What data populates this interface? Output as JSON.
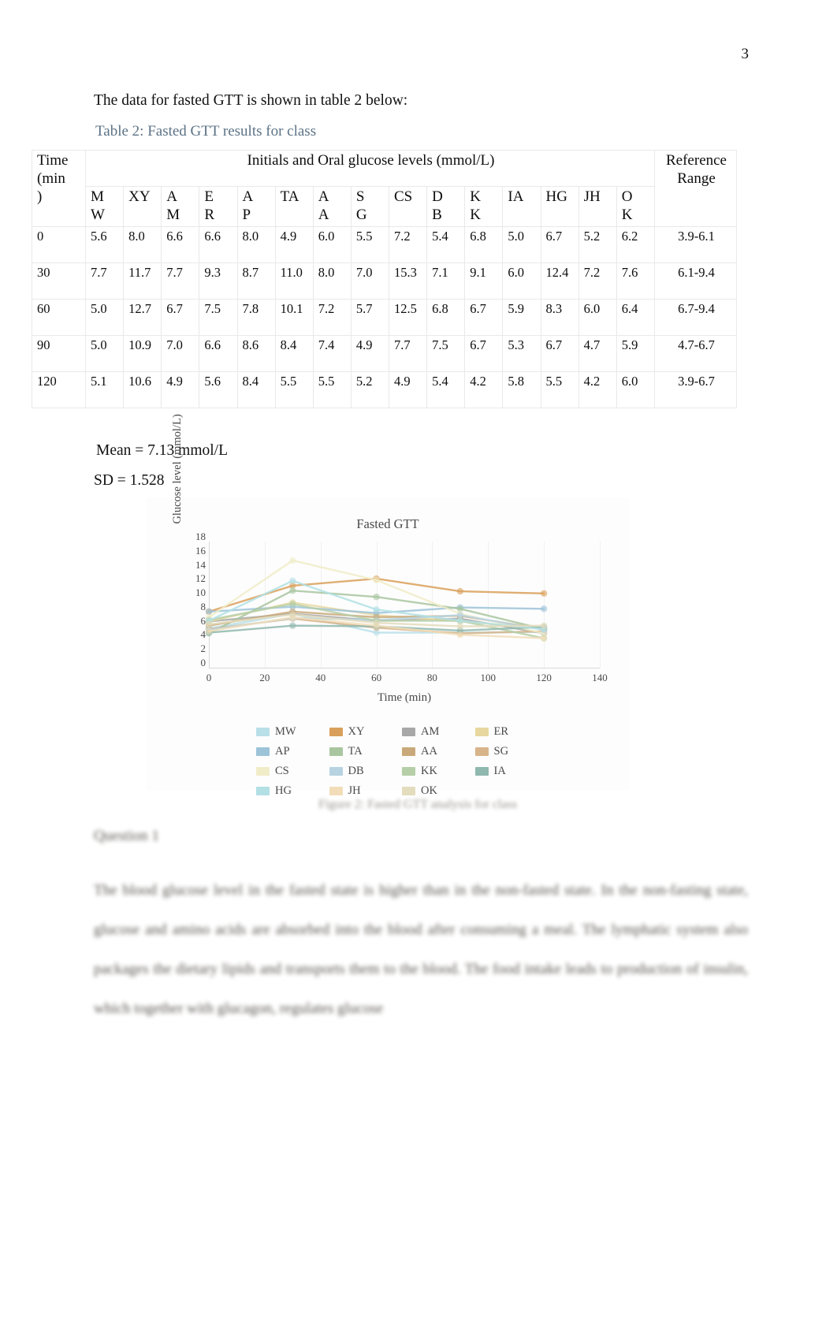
{
  "page": {
    "number": "3",
    "intro_text": "The data for fasted GTT is shown in table 2 below:",
    "table_caption": "Table 2: Fasted GTT results for class",
    "mean_text": "Mean  = 7.13 mmol/L",
    "sd_text": "SD = 1.528",
    "figure_caption": "Figure 2: Fasted GTT analysis for class",
    "question_heading": "Question 1",
    "body_paragraph": "The blood glucose level in the fasted state is higher than in the non-fasted state. In the non-fasting state, glucose and amino acids are absorbed into the blood after consuming a meal. The lymphatic system also packages the dietary lipids and transports them to the blood. The food intake leads to production of insulin, which together with glucagon, regulates glucose"
  },
  "table": {
    "time_header": "Time (min)",
    "time_header_lines": [
      "Time",
      "(min",
      ")"
    ],
    "group_header": "Initials and Oral glucose levels (mmol/L)",
    "reference_header": "Reference Range",
    "reference_header_lines": [
      "Reference",
      "Range"
    ],
    "initials": [
      "MW",
      "XY",
      "AM",
      "ER",
      "AP",
      "TA",
      "AA",
      "SG",
      "CS",
      "DB",
      "KK",
      "IA",
      "HG",
      "JH",
      "OK"
    ],
    "initials_wrapped": [
      [
        "M",
        "W"
      ],
      [
        "XY",
        ""
      ],
      [
        "A",
        "M"
      ],
      [
        "E",
        "R"
      ],
      [
        "A",
        "P"
      ],
      [
        "TA",
        ""
      ],
      [
        "A",
        "A"
      ],
      [
        "S",
        "G"
      ],
      [
        "CS",
        ""
      ],
      [
        "D",
        "B"
      ],
      [
        "K",
        "K"
      ],
      [
        "IA",
        ""
      ],
      [
        "HG",
        ""
      ],
      [
        "JH",
        ""
      ],
      [
        "O",
        "K"
      ]
    ],
    "rows": [
      {
        "time": "0",
        "values": [
          "5.6",
          "8.0",
          "6.6",
          "6.6",
          "8.0",
          "4.9",
          "6.0",
          "5.5",
          "7.2",
          "5.4",
          "6.8",
          "5.0",
          "6.7",
          "5.2",
          "6.2"
        ],
        "reference": "3.9-6.1"
      },
      {
        "time": "30",
        "values": [
          "7.7",
          "11.7",
          "7.7",
          "9.3",
          "8.7",
          "11.0",
          "8.0",
          "7.0",
          "15.3",
          "7.1",
          "9.1",
          "6.0",
          "12.4",
          "7.2",
          "7.6"
        ],
        "reference": "6.1-9.4"
      },
      {
        "time": "60",
        "values": [
          "5.0",
          "12.7",
          "6.7",
          "7.5",
          "7.8",
          "10.1",
          "7.2",
          "5.7",
          "12.5",
          "6.8",
          "6.7",
          "5.9",
          "8.3",
          "6.0",
          "6.4"
        ],
        "reference": "6.7-9.4"
      },
      {
        "time": "90",
        "values": [
          "5.0",
          "10.9",
          "7.0",
          "6.6",
          "8.6",
          "8.4",
          "7.4",
          "4.9",
          "7.7",
          "7.5",
          "6.7",
          "5.3",
          "6.7",
          "4.7",
          "5.9"
        ],
        "reference": "4.7-6.7"
      },
      {
        "time": "120",
        "values": [
          "5.1",
          "10.6",
          "4.9",
          "5.6",
          "8.4",
          "5.5",
          "5.5",
          "5.2",
          "4.9",
          "5.4",
          "4.2",
          "5.8",
          "5.5",
          "4.2",
          "6.0"
        ],
        "reference": "3.9-6.7"
      }
    ]
  },
  "chart_data": {
    "type": "line",
    "title": "Fasted GTT",
    "xlabel": "Time (min)",
    "ylabel": "Glucose level (mmol/L)",
    "x": [
      0,
      30,
      60,
      90,
      120
    ],
    "xlim": [
      0,
      140
    ],
    "ylim": [
      0,
      18
    ],
    "xticks": [
      0,
      20,
      40,
      60,
      80,
      100,
      120,
      140
    ],
    "yticks": [
      0,
      2,
      4,
      6,
      8,
      10,
      12,
      14,
      16,
      18
    ],
    "grid": true,
    "legend_position": "bottom",
    "series": [
      {
        "name": "MW",
        "color": "#b9dfe8",
        "values": [
          5.6,
          7.7,
          5.0,
          5.0,
          5.1
        ]
      },
      {
        "name": "XY",
        "color": "#d9a05b",
        "values": [
          8.0,
          11.7,
          12.7,
          10.9,
          10.6
        ]
      },
      {
        "name": "AM",
        "color": "#a8a8a8",
        "values": [
          6.6,
          7.7,
          6.7,
          7.0,
          4.9
        ]
      },
      {
        "name": "ER",
        "color": "#e8d8a0",
        "values": [
          6.6,
          9.3,
          7.5,
          6.6,
          5.6
        ]
      },
      {
        "name": "AP",
        "color": "#9dc3d8",
        "values": [
          8.0,
          8.7,
          7.8,
          8.6,
          8.4
        ]
      },
      {
        "name": "TA",
        "color": "#a9c6a0",
        "values": [
          4.9,
          11.0,
          10.1,
          8.4,
          5.5
        ]
      },
      {
        "name": "AA",
        "color": "#c9a97a",
        "values": [
          6.0,
          8.0,
          7.2,
          7.4,
          5.5
        ]
      },
      {
        "name": "SG",
        "color": "#d7b48a",
        "values": [
          5.5,
          7.0,
          5.7,
          4.9,
          5.2
        ]
      },
      {
        "name": "CS",
        "color": "#f0ecc8",
        "values": [
          7.2,
          15.3,
          12.5,
          7.7,
          4.9
        ]
      },
      {
        "name": "DB",
        "color": "#b7d3e2",
        "values": [
          5.4,
          7.1,
          6.8,
          7.5,
          5.4
        ]
      },
      {
        "name": "KK",
        "color": "#b6cfa8",
        "values": [
          6.8,
          9.1,
          6.7,
          6.7,
          4.2
        ]
      },
      {
        "name": "IA",
        "color": "#8fb8ae",
        "values": [
          5.0,
          6.0,
          5.9,
          5.3,
          5.8
        ]
      },
      {
        "name": "HG",
        "color": "#b2e0e4",
        "values": [
          6.7,
          12.4,
          8.3,
          6.7,
          5.5
        ]
      },
      {
        "name": "JH",
        "color": "#f2ddb8",
        "values": [
          5.2,
          7.2,
          6.0,
          4.7,
          4.2
        ]
      },
      {
        "name": "OK",
        "color": "#e3dcbd",
        "values": [
          6.2,
          7.6,
          6.4,
          5.9,
          6.0
        ]
      }
    ]
  }
}
